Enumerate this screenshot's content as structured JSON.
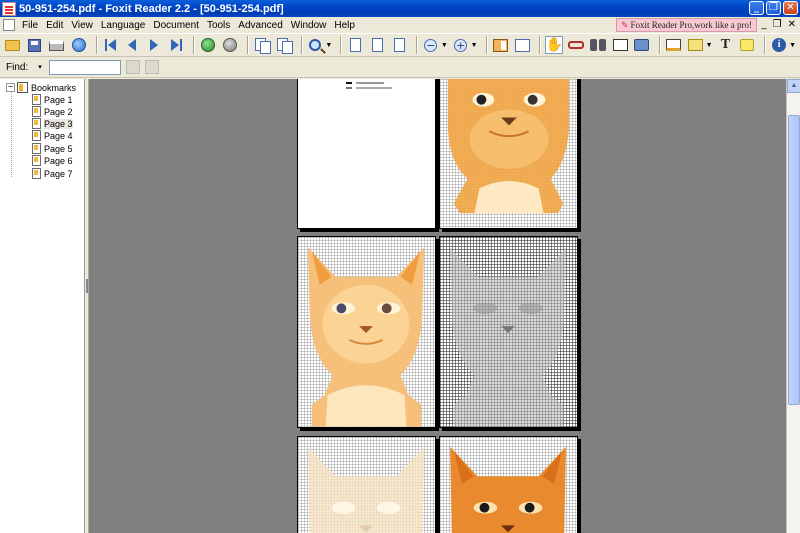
{
  "window": {
    "title": "50-951-254.pdf - Foxit Reader 2.2 - [50-951-254.pdf]",
    "minimize": "_",
    "maximize": "❐",
    "close": "✕"
  },
  "menu": {
    "items": [
      "File",
      "Edit",
      "View",
      "Language",
      "Document",
      "Tools",
      "Advanced",
      "Window",
      "Help"
    ],
    "promo_text": "Foxit Reader Pro,work like a pro!",
    "doc_minimize": "_",
    "doc_restore": "❐",
    "doc_close": "✕"
  },
  "toolbar": {
    "icons": [
      "open-folder-icon",
      "save-icon",
      "print-icon",
      "email-icon",
      "first-page-icon",
      "previous-page-icon",
      "next-page-icon",
      "last-page-icon",
      "go-back-icon",
      "go-forward-icon",
      "rotate-left-icon",
      "rotate-right-icon",
      "zoom-icon",
      "actual-size-icon",
      "fit-page-icon",
      "fit-width-icon",
      "zoom-out-icon",
      "zoom-in-icon",
      "bookmarks-panel-icon",
      "thumbnails-panel-icon",
      "hand-tool-icon",
      "reading-glasses-icon",
      "find-icon",
      "snapshot-frame-icon",
      "snapshot-camera-icon",
      "typewriter-icon",
      "highlight-icon",
      "text-tool-icon",
      "note-icon",
      "info-icon"
    ],
    "zoom_minus_glyph": "−",
    "zoom_plus_glyph": "+",
    "text_tool_glyph": "T",
    "info_glyph": "i",
    "hand_glyph": "✋"
  },
  "findbar": {
    "label": "Find:",
    "value": "",
    "dropdown_glyph": "▾"
  },
  "bookmarks": {
    "expander": "−",
    "root_label": "Bookmarks",
    "items": [
      {
        "label": "Page 1",
        "selected": false
      },
      {
        "label": "Page 2",
        "selected": false
      },
      {
        "label": "Page 3",
        "selected": true
      },
      {
        "label": "Page 4",
        "selected": false
      },
      {
        "label": "Page 5",
        "selected": false
      },
      {
        "label": "Page 6",
        "selected": false
      },
      {
        "label": "Page 7",
        "selected": false
      }
    ]
  },
  "document": {
    "view": "two-page continuous facing",
    "page_contents": [
      "legend-key",
      "color-cat-pattern",
      "color-cat-pattern",
      "symbol-cat-grid",
      "faded-cat-pattern",
      "deep-orange-cat-pattern"
    ]
  },
  "colors": {
    "title_bar": "#0046c8",
    "workspace": "#808080",
    "chrome": "#ece9d8",
    "cat_orange": "#f0a040",
    "cat_light": "#fbd9a0"
  }
}
